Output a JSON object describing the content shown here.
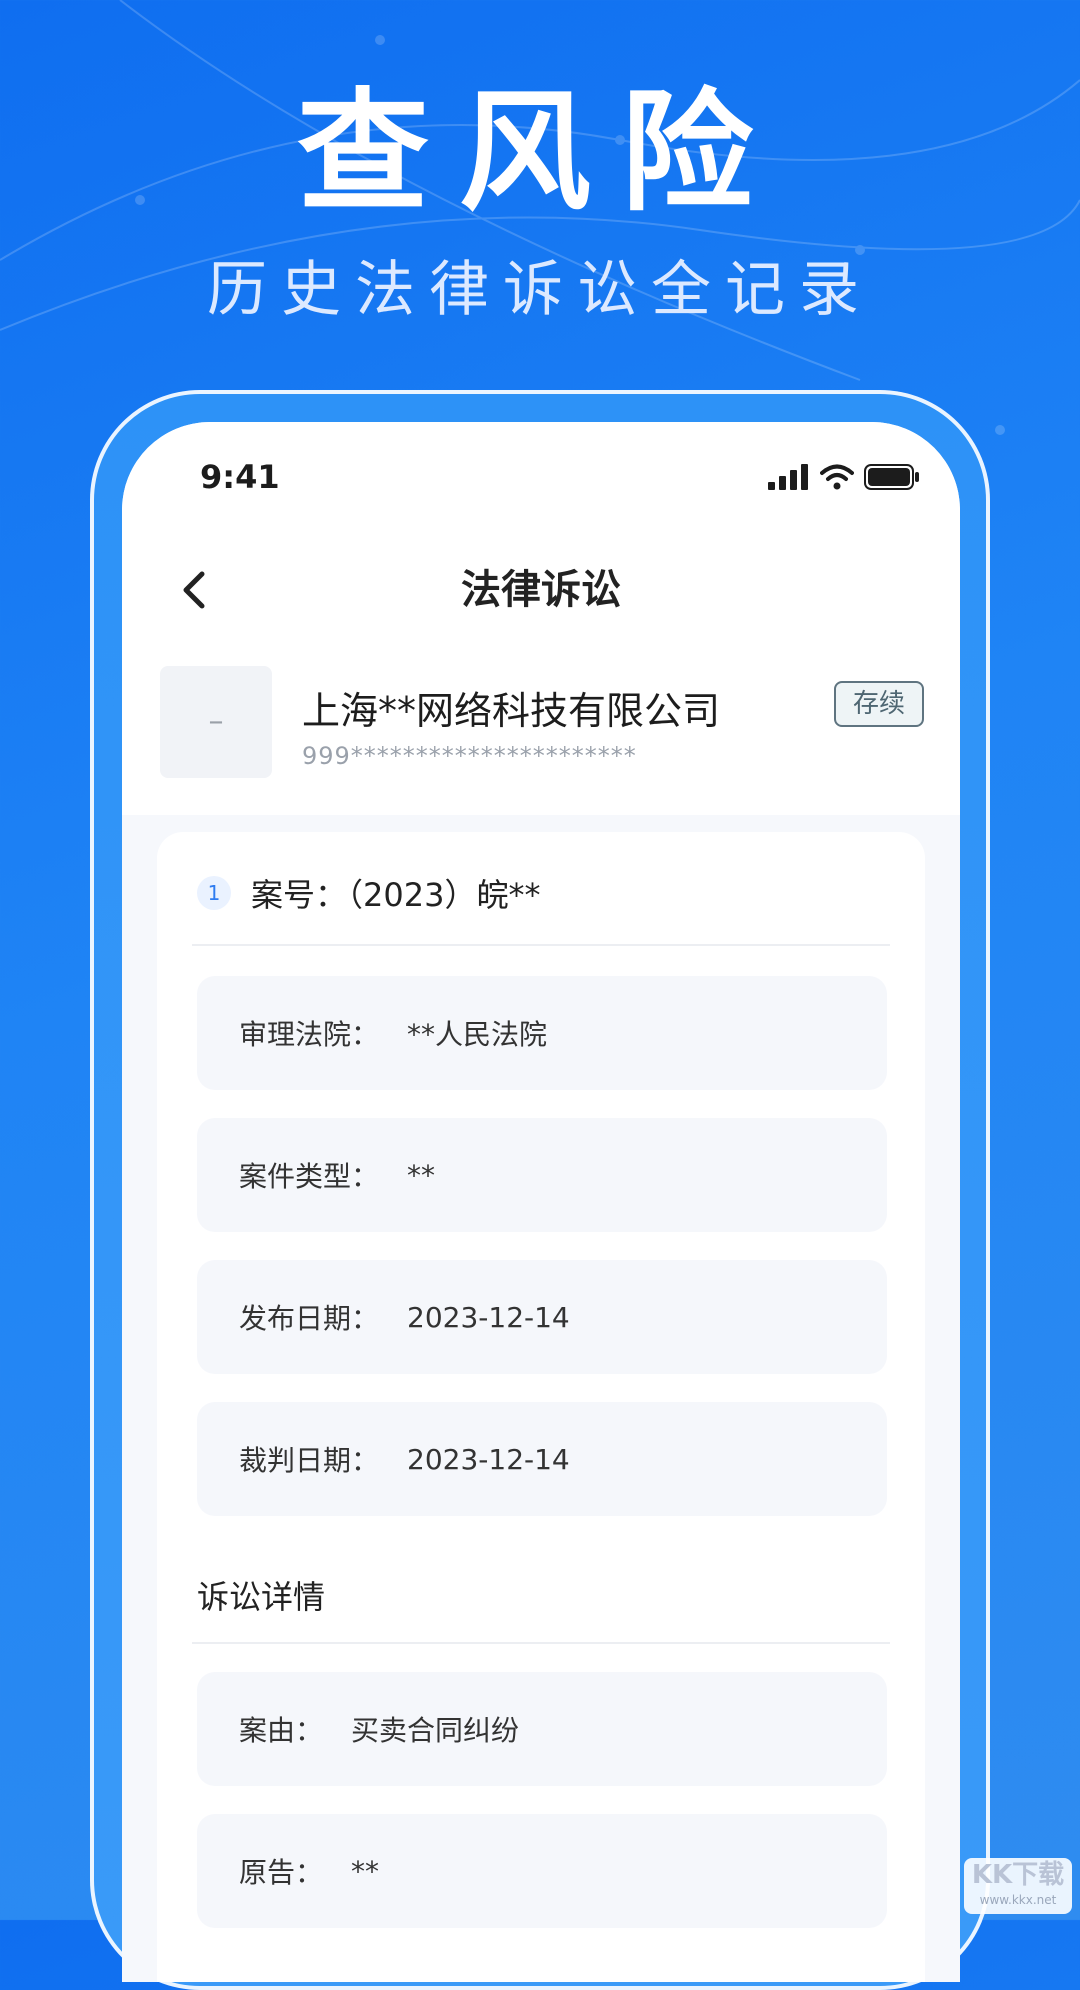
{
  "hero": {
    "title": "查风险",
    "subtitle": "历史法律诉讼全记录"
  },
  "status_bar": {
    "time": "9:41",
    "icons": [
      "signal-icon",
      "wifi-icon",
      "battery-icon"
    ]
  },
  "nav": {
    "back_icon": "chevron-left-icon",
    "title": "法律诉讼"
  },
  "company": {
    "logo_placeholder": "–",
    "name": "上海**网络科技有限公司",
    "code": "999**********************",
    "status": "存续"
  },
  "case": {
    "index": "1",
    "title": "案号：（2023）皖**",
    "fields": [
      {
        "label": "审理法院：",
        "value": "**人民法院"
      },
      {
        "label": "案件类型：",
        "value": "**"
      },
      {
        "label": "发布日期：",
        "value": "2023-12-14"
      },
      {
        "label": "裁判日期：",
        "value": "2023-12-14"
      }
    ]
  },
  "details": {
    "section_title": "诉讼详情",
    "fields": [
      {
        "label": "案由：",
        "value": "买卖合同纠纷"
      },
      {
        "label": "原告：",
        "value": "**"
      }
    ]
  },
  "watermark": {
    "brand": "KK下载",
    "site": "www.kkx.net"
  },
  "colors": {
    "background": "#1f84f5",
    "accent": "#2f7cf0",
    "badge_border": "#5f7480"
  }
}
